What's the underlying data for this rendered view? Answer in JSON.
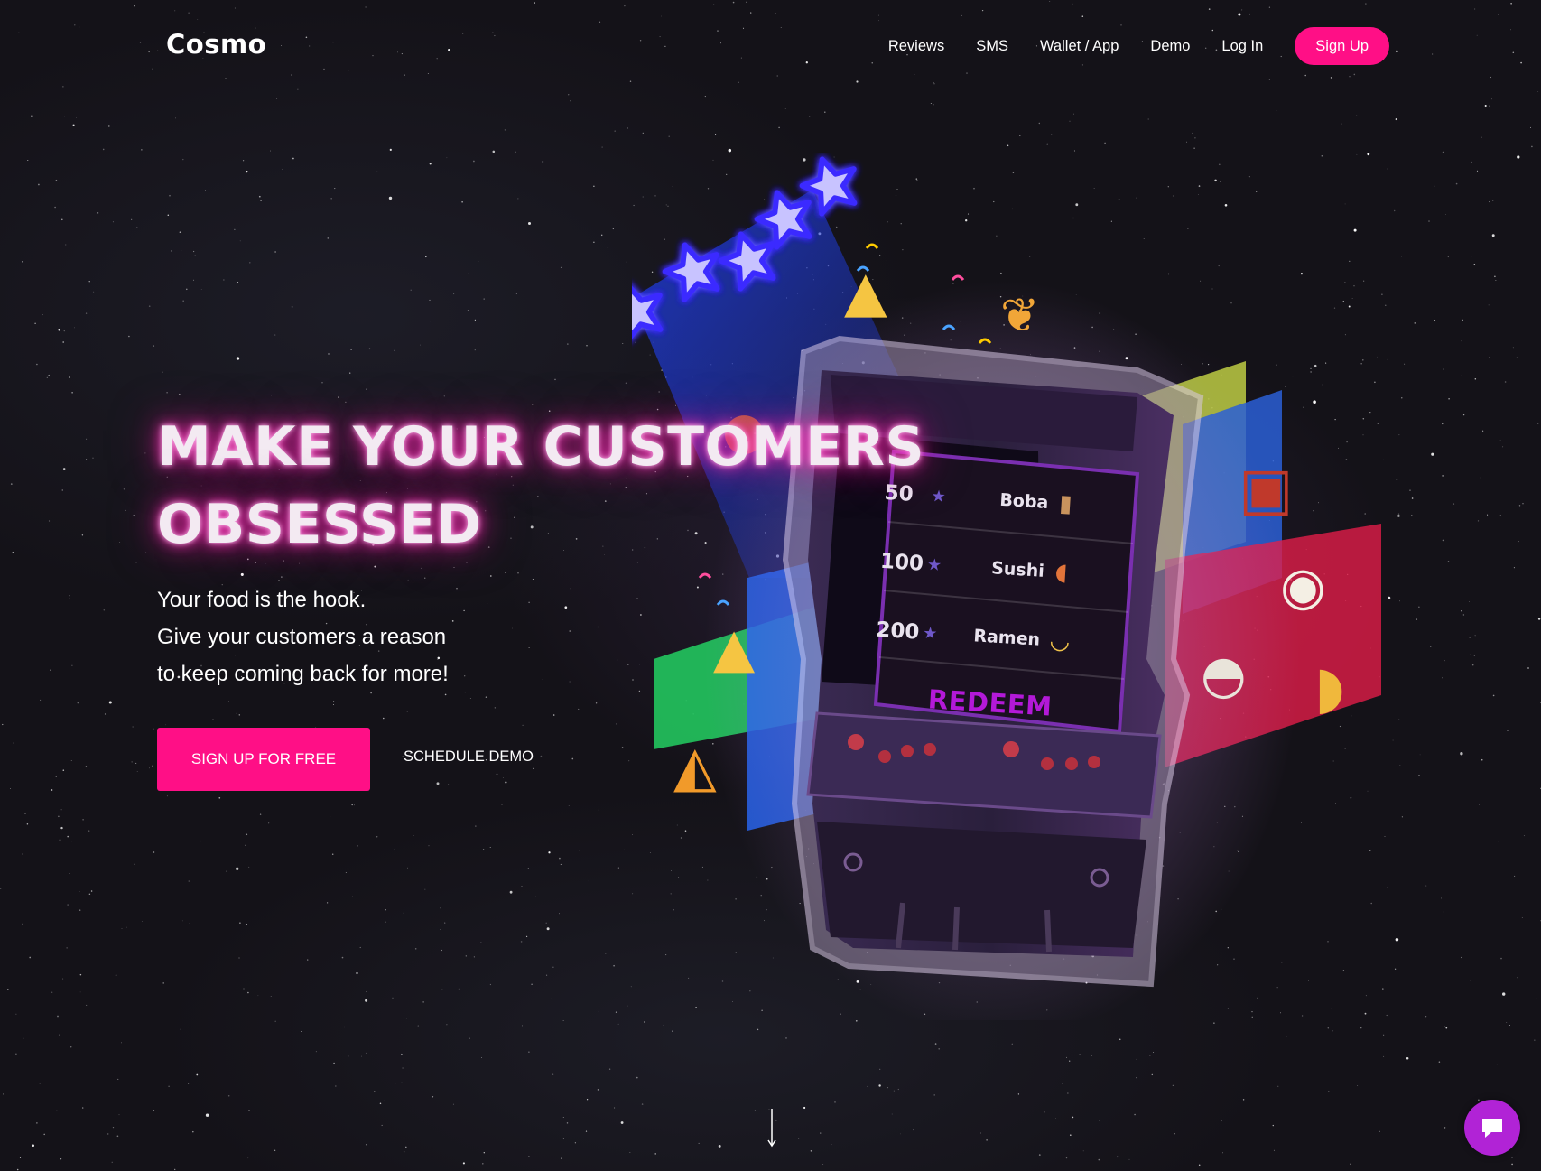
{
  "brand": {
    "name": "Cosmo",
    "accent_color": "#ff0f86",
    "chat_color": "#b123d6"
  },
  "nav": {
    "links": [
      "Reviews",
      "SMS",
      "Wallet / App",
      "Demo",
      "Log In"
    ],
    "signup_label": "Sign Up"
  },
  "hero": {
    "title_lines": [
      "MAKE YOUR CUSTOMERS",
      "OBSESSED"
    ],
    "subtitle_lines": [
      "Your food is the hook.",
      "Give your customers a reason",
      "to keep coming back for more!"
    ],
    "primary_cta": "SIGN UP FOR FREE",
    "secondary_cta": "SCHEDULE DEMO"
  },
  "arcade_menu": {
    "rows": [
      {
        "points": "50",
        "item": "Boba",
        "icon": "boba-tea-icon"
      },
      {
        "points": "100",
        "item": "Sushi",
        "icon": "sushi-icon"
      },
      {
        "points": "200",
        "item": "Ramen",
        "icon": "ramen-icon"
      }
    ],
    "redeem_label": "REDEEM",
    "star_icon": "star-icon"
  },
  "decorations": {
    "stars_count": 5,
    "floating_icons": [
      "party-popper-icon",
      "bells-icon",
      "bento-box-icon",
      "curry-rice-icon",
      "soup-bowl-icon",
      "taco-icon",
      "pizza-icon",
      "burger-icon"
    ]
  },
  "scroll_icon": "down-arrow-icon",
  "chat_icon": "chat-bubble-icon"
}
